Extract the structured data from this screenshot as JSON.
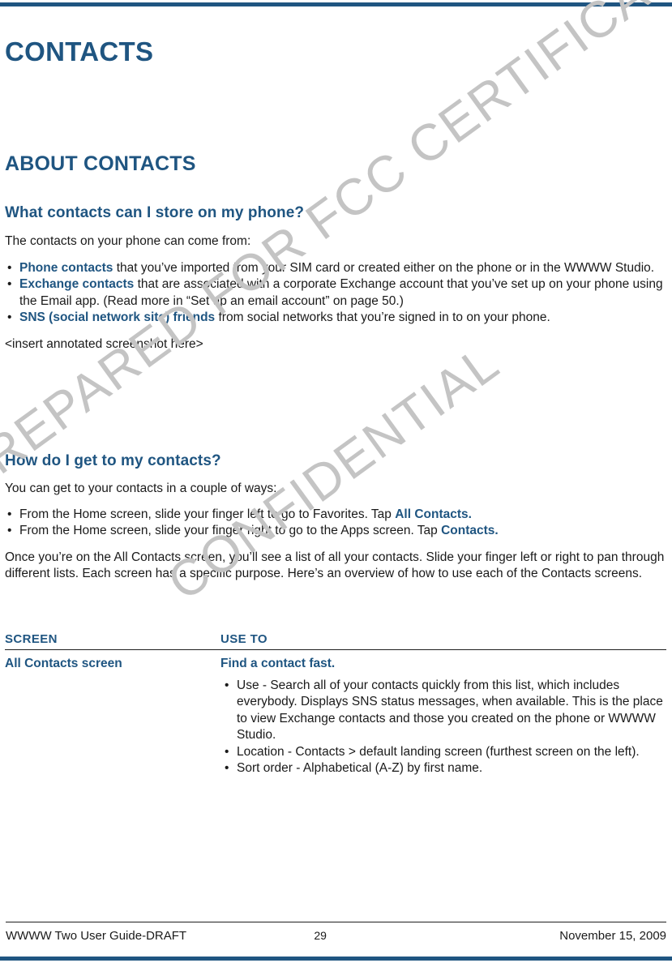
{
  "document": {
    "chapter_title": "CONTACTS",
    "section_heading": "ABOUT CONTACTS",
    "accent_color": "#1f5581",
    "rule_color": "#1f5581",
    "body_color": "#1a1a1a",
    "watermark_color": "#c4c4c4"
  },
  "watermarks": {
    "line1": "PREPARED FOR FCC CERTIFICATION",
    "line2": "CONFIDENTIAL"
  },
  "subsection_1": {
    "heading": "What contacts can I store on my phone?",
    "intro": "The contacts on your phone can come from:",
    "bullets": [
      {
        "lead": "Phone contacts",
        "rest": " that you’ve imported from your SIM card or created either on the phone or in the WWWW Studio."
      },
      {
        "lead": "Exchange contacts",
        "rest": " that are associated with a corporate Exchange account that you’ve set up on your phone using the Email app. (Read more in “Set up an email account” on page 50.)"
      },
      {
        "lead": "SNS (social network site) friends",
        "rest": " from social networks that you’re signed in to on your phone."
      }
    ],
    "placeholder_note": "<insert annotated screenshot here>"
  },
  "subsection_2": {
    "heading": "How do I get to my contacts?",
    "intro": "You can get to your contacts in a couple of ways:",
    "bullets": [
      {
        "rest": "From the Home screen, slide your finger left to go to Favorites. Tap ",
        "trail": "All Contacts."
      },
      {
        "rest": "From the Home screen, slide your finger right to go to the Apps screen. Tap ",
        "trail": "Contacts."
      }
    ],
    "outro": "Once you’re on the All Contacts screen, you’ll see a list of all your contacts. Slide your finger left or right to pan through different lists. Each screen has a specific purpose. Here’s an overview of how to use each of the Contacts screens."
  },
  "table": {
    "headers": {
      "col1": "SCREEN",
      "col2": "USE TO"
    },
    "rows": [
      {
        "screen": "All Contacts screen",
        "use_to_title": "Find a contact fast.",
        "use_to_bullets": [
          "Use - Search all of your contacts quickly from this list, which includes everybody. Displays SNS status messages, when available. This is the place to view Exchange contacts and those you created on the phone or WWWW Studio.",
          "Location - Contacts > default landing screen (furthest screen on the left).",
          "Sort order - Alphabetical (A-Z) by first name."
        ]
      }
    ]
  },
  "footer": {
    "left": "WWWW Two User Guide-DRAFT",
    "page_number": "29",
    "right": "November 15, 2009"
  }
}
